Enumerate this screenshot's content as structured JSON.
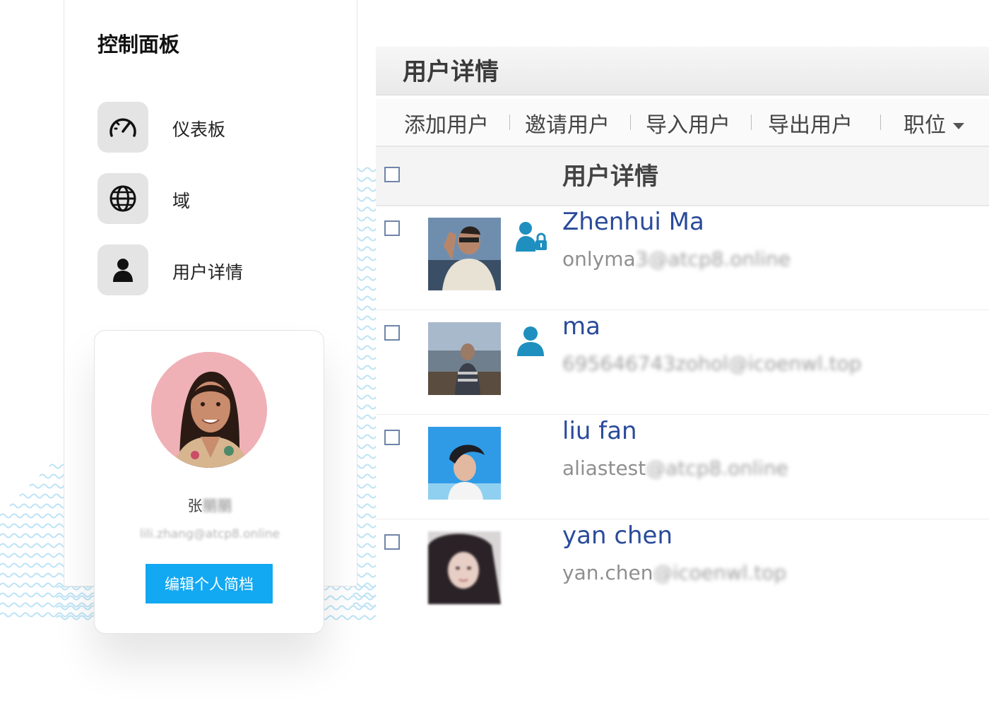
{
  "sidebar": {
    "title": "控制面板",
    "items": [
      {
        "label": "仪表板",
        "icon": "speedometer-icon"
      },
      {
        "label": "域",
        "icon": "globe-icon"
      },
      {
        "label": "用户详情",
        "icon": "user-icon"
      }
    ]
  },
  "profile": {
    "name_visible": "张",
    "name_blurred": "丽丽",
    "email": "lili.zhang@atcp8.online",
    "edit_button": "编辑个人简档",
    "avatar_bg": "#efb1b6"
  },
  "main": {
    "title": "用户详情",
    "toolbar": [
      "添加用户",
      "邀请用户",
      "导入用户",
      "导出用户",
      "职位"
    ],
    "table_header": "用户详情",
    "users": [
      {
        "name": "Zhenhui Ma",
        "email_visible": "onlyma",
        "email_blurred": "3@atcp8.online",
        "role_icon": "user-lock-icon"
      },
      {
        "name": "ma",
        "email_visible": "",
        "email_blurred": "695646743zohol@icoenwl.top",
        "role_icon": "user-icon"
      },
      {
        "name": "liu fan",
        "email_visible": "aliastest",
        "email_blurred": "@atcp8.online",
        "role_icon": ""
      },
      {
        "name": "yan chen",
        "email_visible": "yan.chen",
        "email_blurred": "@icoenwl.top",
        "role_icon": ""
      }
    ]
  },
  "colors": {
    "accent": "#12a8f2",
    "link": "#2a4b9a",
    "role_icon": "#1f8fbf",
    "waves": "#bde3f6"
  }
}
